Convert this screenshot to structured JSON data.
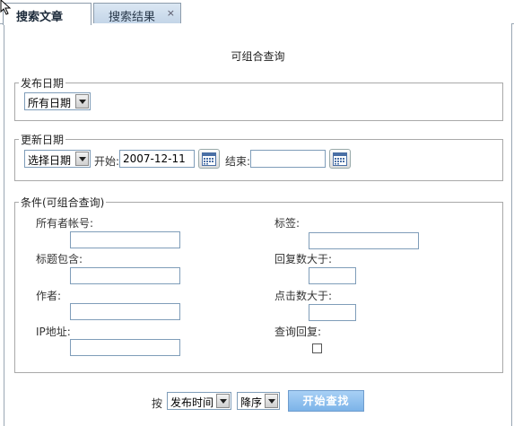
{
  "tabs": [
    {
      "label": "搜索文章",
      "active": true
    },
    {
      "label": "搜索结果",
      "active": false
    }
  ],
  "tab_close_glyph": "×",
  "title": "可组合查询",
  "publish_date": {
    "legend": "发布日期",
    "select_value": "所有日期"
  },
  "update_date": {
    "legend": "更新日期",
    "select_value": "选择日期",
    "start_label": "开始:",
    "start_value": "2007-12-11",
    "end_label": "结束:",
    "end_value": ""
  },
  "conditions": {
    "legend": "条件(可组合查询)",
    "owner_account_label": "所有者帐号:",
    "title_contains_label": "标题包含:",
    "author_label": "作者:",
    "ip_label": "IP地址:",
    "tags_label": "标签:",
    "replies_gt_label": "回复数大于:",
    "clicks_gt_label": "点击数大于:",
    "query_replies_label": "查询回复:",
    "query_replies_checked": false
  },
  "footer": {
    "sort_prefix": "按",
    "sort_field": "发布时间",
    "sort_order": "降序",
    "submit_label": "开始查找"
  },
  "colors": {
    "accent": "#7cb3e8",
    "tab_inactive": "#c2d4e7",
    "border": "#a9a9a9"
  },
  "icons": [
    "cursor-arrow-icon",
    "calendar-icon",
    "close-icon",
    "dropdown-arrow-icon"
  ]
}
